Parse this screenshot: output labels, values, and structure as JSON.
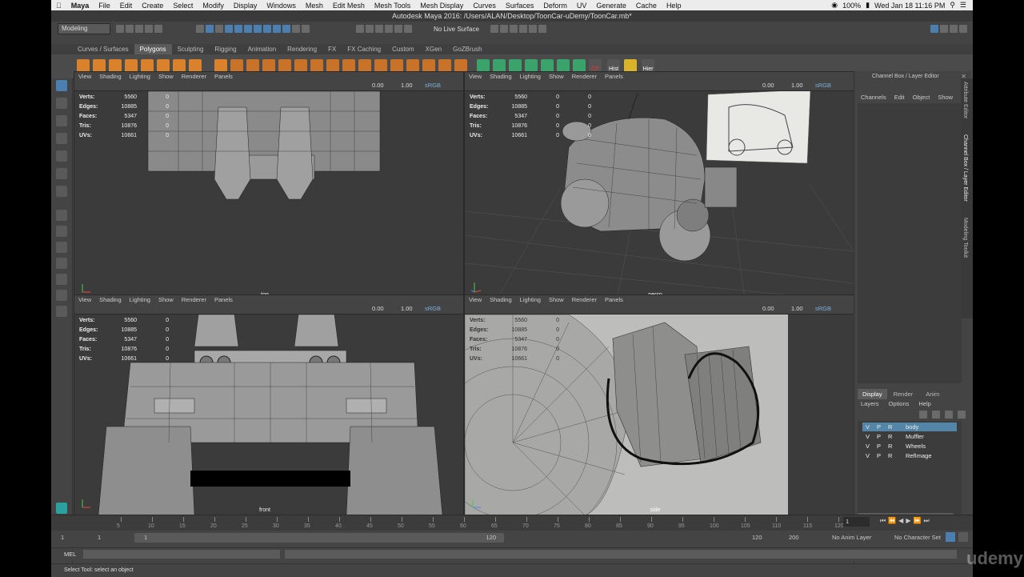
{
  "menubar": {
    "apple": "",
    "items": [
      "Maya",
      "File",
      "Edit",
      "Create",
      "Select",
      "Modify",
      "Display",
      "Windows",
      "Mesh",
      "Edit Mesh",
      "Mesh Tools",
      "Mesh Display",
      "Curves",
      "Surfaces",
      "Deform",
      "UV",
      "Generate",
      "Cache",
      "Help"
    ],
    "battery": "100%",
    "clock": "Wed Jan 18  11:16 PM"
  },
  "window": {
    "title": "Autodesk Maya 2016: /Users/ALAN/Desktop/ToonCar-uDemy/ToonCar.mb*"
  },
  "toolbar": {
    "mode": "Modeling",
    "live_surface": "No Live Surface"
  },
  "shelf": {
    "tabs": [
      "Curves / Surfaces",
      "Polygons",
      "Sculpting",
      "Rigging",
      "Animation",
      "Rendering",
      "FX",
      "FX Caching",
      "Custom",
      "XGen",
      "GoZBrush"
    ],
    "active_tab": "Polygons",
    "icon_labels": [
      "CP",
      "Hist",
      "Hier"
    ]
  },
  "viewport_menu": [
    "View",
    "Shading",
    "Lighting",
    "Show",
    "Renderer",
    "Panels"
  ],
  "viewport_fields": {
    "a": "0.00",
    "b": "1.00",
    "c": "sRGB"
  },
  "hud": {
    "labels": [
      "Verts:",
      "Edges:",
      "Faces:",
      "Tris:",
      "UVs:"
    ],
    "values": [
      "5560",
      "10885",
      "5347",
      "10876",
      "10661"
    ],
    "zeros": [
      "0",
      "0",
      "0",
      "0",
      "0"
    ]
  },
  "viewports": {
    "top": "top",
    "persp": "persp",
    "front": "front",
    "side": "side"
  },
  "channel_box": {
    "title": "Channel Box / Layer Editor",
    "menu": [
      "Channels",
      "Edit",
      "Object",
      "Show"
    ]
  },
  "layer_editor": {
    "tabs": [
      "Display",
      "Render",
      "Anim"
    ],
    "menu": [
      "Layers",
      "Options",
      "Help"
    ],
    "layers": [
      {
        "v": "V",
        "p": "P",
        "r": "R",
        "name": "body",
        "selected": true
      },
      {
        "v": "V",
        "p": "P",
        "r": "R",
        "name": "Muffler",
        "selected": false
      },
      {
        "v": "V",
        "p": "P",
        "r": "R",
        "name": "Wheels",
        "selected": false
      },
      {
        "v": "V",
        "p": "P",
        "r": "R",
        "name": "RefImage",
        "selected": false
      }
    ]
  },
  "side_tabs": [
    "Attribute Editor",
    "Channel Box / Layer Editor",
    "Modeling Toolkit"
  ],
  "timeline": {
    "ticks": [
      "5",
      "10",
      "15",
      "20",
      "25",
      "30",
      "35",
      "40",
      "45",
      "50",
      "55",
      "60",
      "65",
      "70",
      "75",
      "80",
      "85",
      "90",
      "95",
      "100",
      "105",
      "110",
      "115",
      "120"
    ],
    "current_frame": "1"
  },
  "range": {
    "start": "1",
    "start2": "1",
    "slider_start": "1",
    "slider_end": "120",
    "end": "120",
    "end2": "200",
    "anim_layer": "No Anim Layer",
    "char_set": "No Character Set"
  },
  "mel": {
    "label": "MEL"
  },
  "status": {
    "text": "Select Tool: select an object"
  },
  "watermark": "udemy"
}
